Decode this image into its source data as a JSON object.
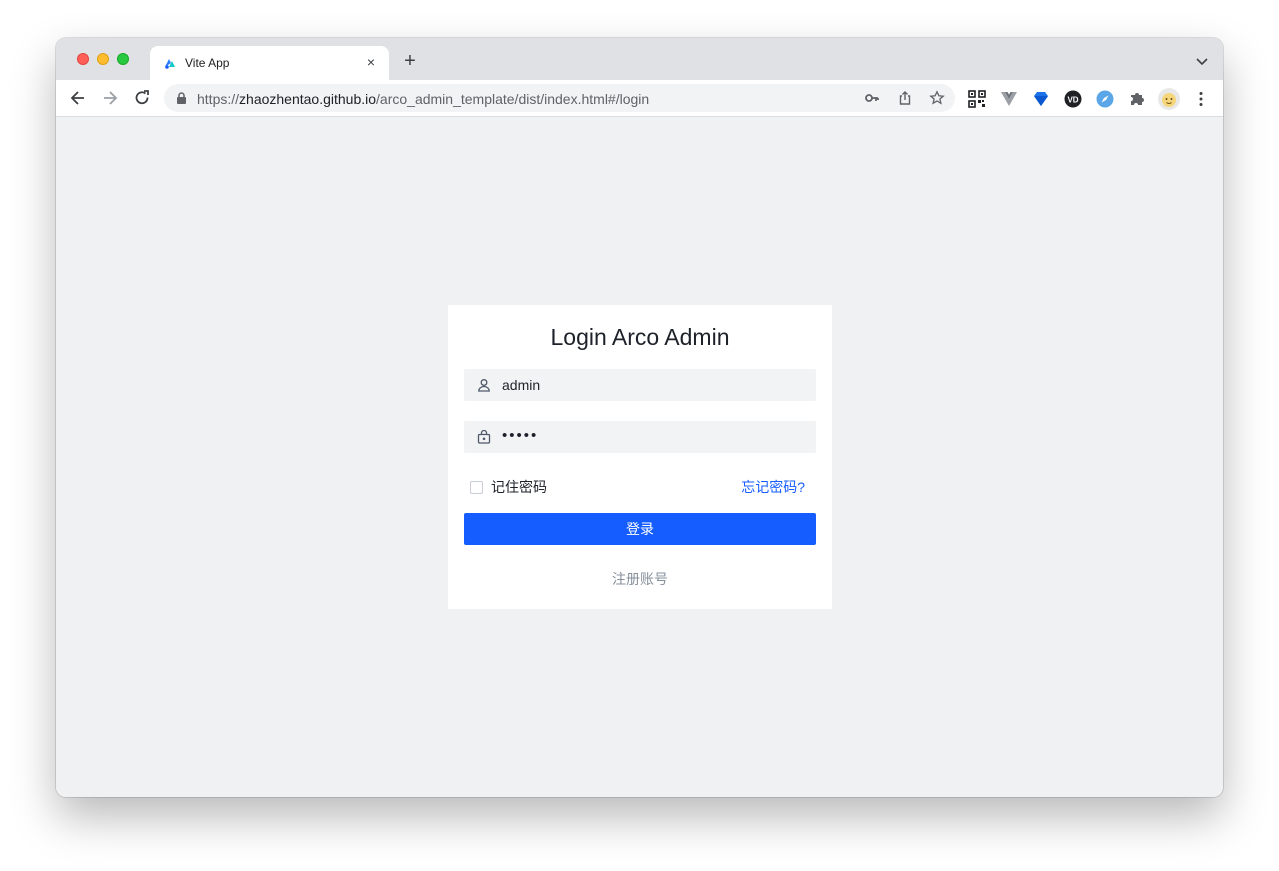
{
  "browser": {
    "tab": {
      "title": "Vite App",
      "close_label": "×"
    },
    "new_tab_label": "+",
    "address": {
      "scheme": "https://",
      "host": "zhaozhentao.github.io",
      "path": "/arco_admin_template/dist/index.html#/login"
    },
    "icons": {
      "nav": [
        "back-icon",
        "forward-icon",
        "reload-icon"
      ],
      "omnibox": [
        "key-icon",
        "share-icon",
        "star-icon"
      ],
      "extensions": [
        "qr-code-icon",
        "vue-devtools-icon",
        "diamond-extension-icon",
        "vd-extension-icon",
        "compass-extension-icon",
        "puzzle-icon",
        "profile-avatar",
        "more-menu-icon"
      ]
    }
  },
  "login": {
    "title": "Login Arco Admin",
    "username": {
      "value": "admin",
      "icon": "user-icon"
    },
    "password": {
      "value": "•••••",
      "icon": "lock-icon"
    },
    "remember_label": "记住密码",
    "remember_checked": false,
    "forgot_label": "忘记密码?",
    "submit_label": "登录",
    "register_label": "注册账号",
    "colors": {
      "primary": "#165dff",
      "background": "#f0f1f3",
      "field_bg": "#f2f3f5"
    }
  }
}
